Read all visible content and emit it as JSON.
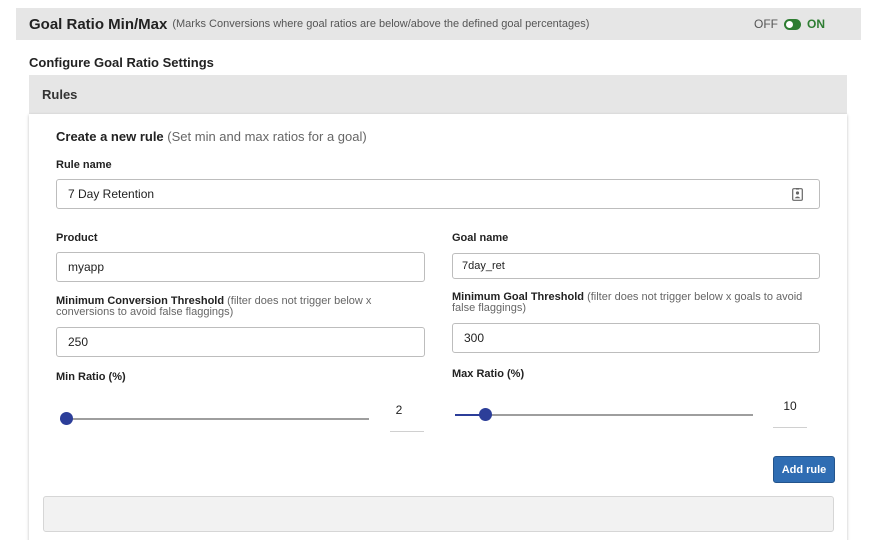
{
  "header": {
    "title": "Goal Ratio Min/Max",
    "description": "(Marks Conversions where goal ratios are below/above the defined goal percentages)",
    "toggle_off_label": "OFF",
    "toggle_on_label": "ON",
    "toggle_state": "on",
    "accent_color": "#2e7d32"
  },
  "section_title": "Configure Goal Ratio Settings",
  "rules_tab_label": "Rules",
  "form": {
    "title": "Create a new rule",
    "subtitle": "(Set min and max ratios for a goal)",
    "rule_name": {
      "label": "Rule name",
      "value": "7 Day Retention",
      "icon": "contact-badge-icon"
    },
    "product": {
      "label": "Product",
      "value": "myapp"
    },
    "goal_name": {
      "label": "Goal name",
      "value": "7day_ret"
    },
    "min_conversion_threshold": {
      "label": "Minimum Conversion Threshold",
      "hint": "(filter does not trigger below x conversions to avoid false flaggings)",
      "value": "250"
    },
    "min_goal_threshold": {
      "label": "Minimum Goal Threshold",
      "hint": "(filter does not trigger below x goals to avoid false flaggings)",
      "value": "300"
    },
    "min_ratio": {
      "label": "Min Ratio (%)",
      "value": "2",
      "level": 0.0
    },
    "max_ratio": {
      "label": "Max Ratio (%)",
      "value": "10",
      "level": 0.1
    },
    "add_button_label": "Add rule",
    "slider_color": "#2c3e99",
    "button_color": "#2f6db3"
  }
}
